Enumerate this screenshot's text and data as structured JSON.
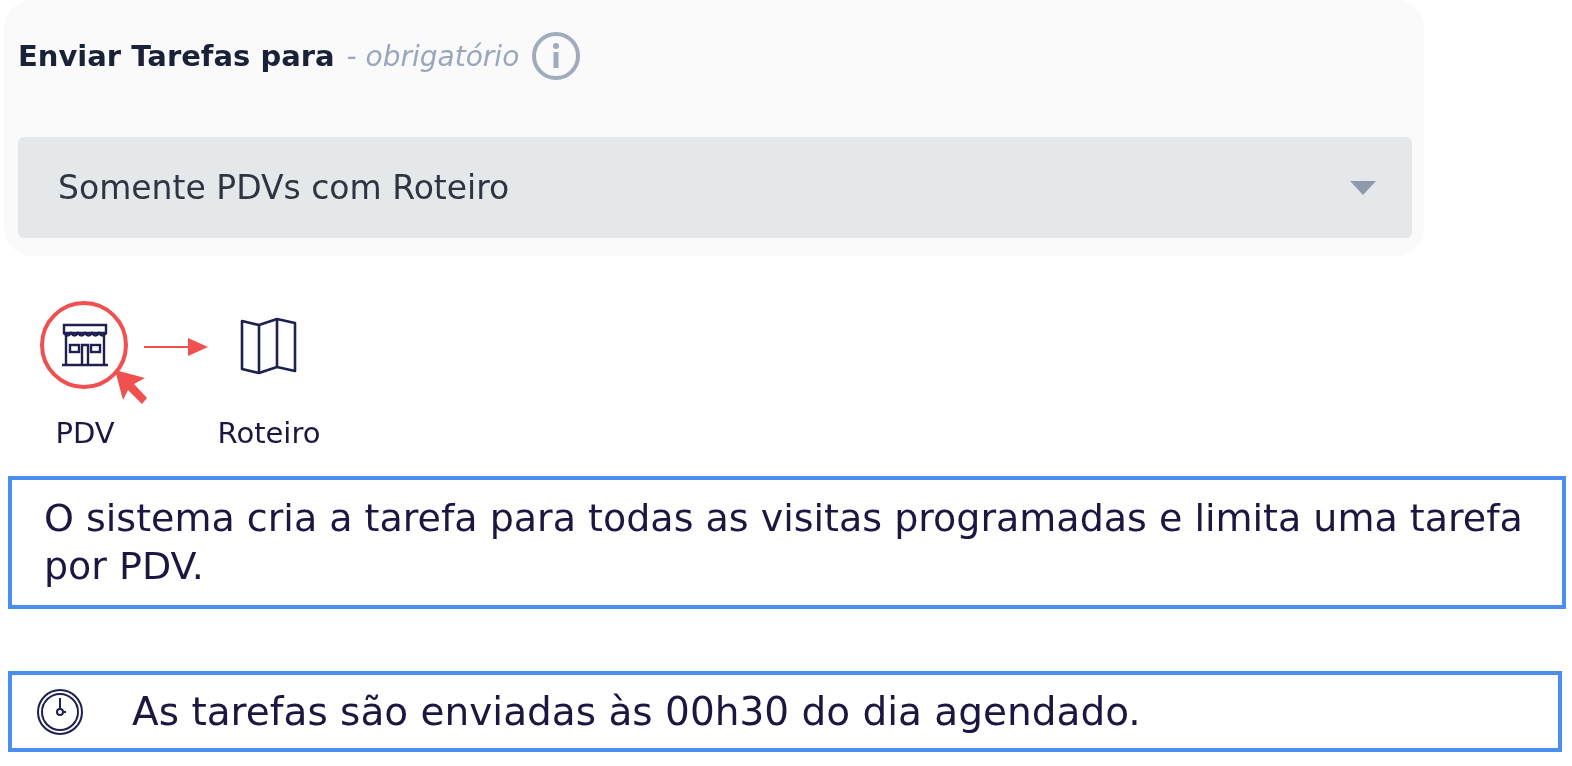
{
  "card": {
    "title": "Enviar Tarefas para",
    "hint": "- obrigatório",
    "select": {
      "value": "Somente PDVs com Roteiro"
    }
  },
  "flow": [
    {
      "label": "PDV",
      "kind": "store",
      "highlighted": true
    },
    {
      "label": "Roteiro",
      "kind": "map",
      "highlighted": false
    }
  ],
  "note": "O sistema cria a tarefa para todas as visitas programadas e limita uma tarefa por PDV.",
  "schedule": "As tarefas são enviadas às 00h30 do dia agendado."
}
